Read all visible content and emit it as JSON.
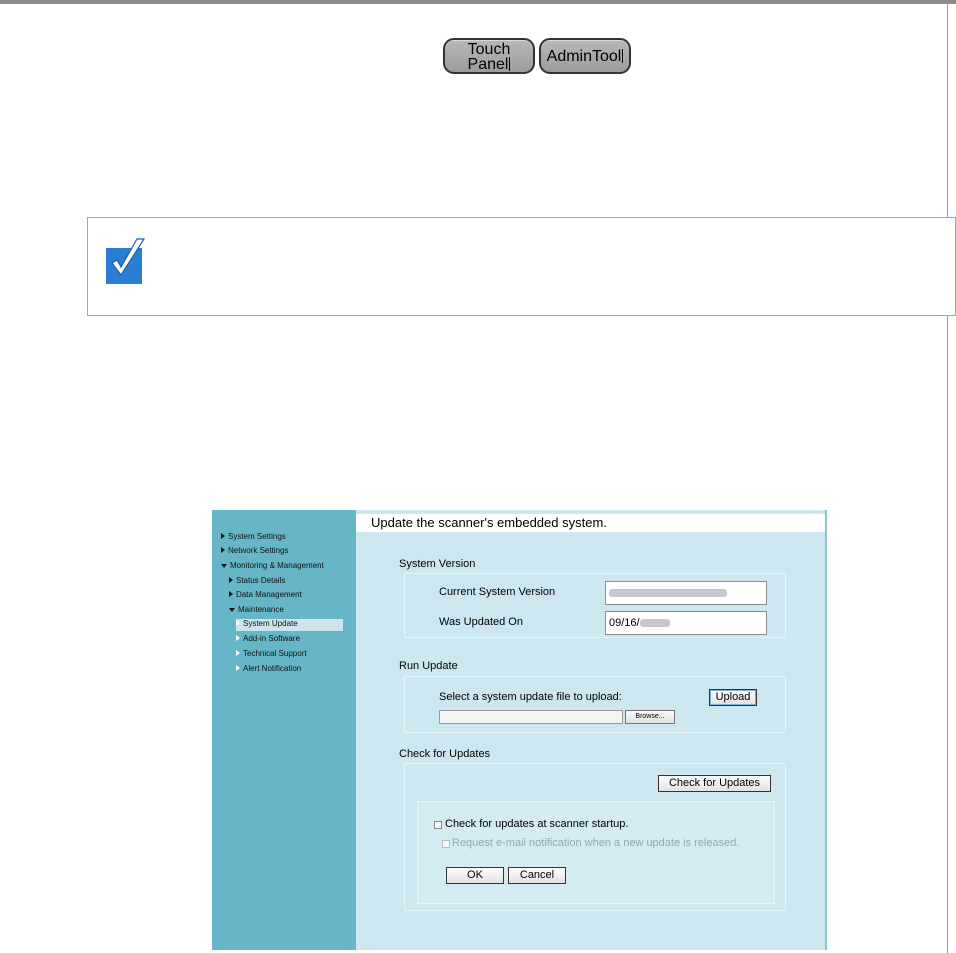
{
  "mode_buttons": {
    "touch_panel": {
      "line1": "Touch",
      "line2": "Panel"
    },
    "admin_tool": {
      "label": "AdminTool"
    }
  },
  "hint": {
    "icon": "checkmark-icon",
    "accent": "#2a7fd4",
    "border": "#56c9bf"
  },
  "admin_ui": {
    "sidebar": {
      "items": [
        {
          "label": "System Settings"
        },
        {
          "label": "Network Settings"
        },
        {
          "label": "Monitoring & Management"
        },
        {
          "label": "Status Details"
        },
        {
          "label": "Data Management"
        },
        {
          "label": "Maintenance"
        },
        {
          "label": "System Update"
        },
        {
          "label": "Add-in Software"
        },
        {
          "label": "Technical Support"
        },
        {
          "label": "Alert Notification"
        }
      ],
      "selected": "System Update"
    },
    "title": "Update the scanner's embedded system.",
    "system_version": {
      "section_label": "System Version",
      "current_label": "Current System Version",
      "current_value": "",
      "updated_label": "Was Updated On",
      "updated_value": "09/16/"
    },
    "run_update": {
      "section_label": "Run Update",
      "select_label": "Select a system update file to upload:",
      "upload_button": "Upload",
      "browse_button": "Browse..."
    },
    "check_updates": {
      "section_label": "Check for Updates",
      "check_button": "Check for Updates",
      "startup_checkbox_label": "Check for updates at scanner startup.",
      "startup_checked": false,
      "email_checkbox_label": "Request e-mail notification when a new update is released.",
      "email_checked": false,
      "ok_button": "OK",
      "cancel_button": "Cancel"
    },
    "colors": {
      "sidebar": "#66b6c7",
      "content": "#cde7f1"
    }
  }
}
